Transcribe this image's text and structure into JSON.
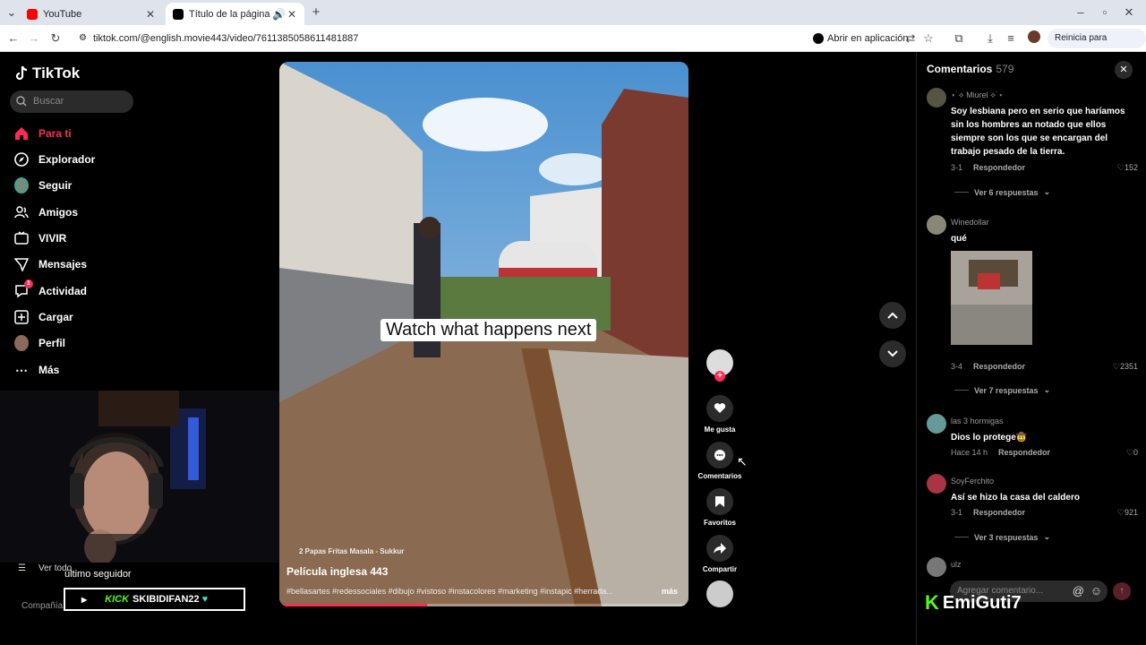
{
  "browser": {
    "tabs": [
      {
        "title": "YouTube",
        "favicon_color": "#ff0000"
      },
      {
        "title": "Título de la página de inicio",
        "favicon_color": "#000000"
      }
    ],
    "url": "tiktok.com/@english.movie443/video/7611385058611481887",
    "open_in_app": "Abrir en aplicación",
    "restart": "Reinicia para actualizar"
  },
  "sidebar": {
    "logo": "TikTok",
    "search_placeholder": "Buscar",
    "nav": [
      {
        "label": "Para ti",
        "icon": "home-icon"
      },
      {
        "label": "Explorador",
        "icon": "compass-icon"
      },
      {
        "label": "Seguir",
        "icon": "following-avatar-icon"
      },
      {
        "label": "Amigos",
        "icon": "friends-icon"
      },
      {
        "label": "VIVIR",
        "icon": "live-icon"
      },
      {
        "label": "Mensajes",
        "icon": "messages-icon"
      },
      {
        "label": "Actividad",
        "icon": "activity-icon",
        "badge": "1"
      },
      {
        "label": "Cargar",
        "icon": "upload-icon"
      },
      {
        "label": "Perfil",
        "icon": "profile-avatar-icon"
      },
      {
        "label": "Más",
        "icon": "more-icon"
      }
    ],
    "ver_todo": "Ver todo",
    "footer": "Compañía"
  },
  "stream_overlay": {
    "last_follower_label": "último seguidor",
    "kick_brand": "KICK",
    "follower_name": "SKIBIDIFAN22",
    "streamer_handle": "EmiGuti7"
  },
  "video": {
    "overlay_text": "Watch what happens next",
    "sound": "2 Papas Fritas Masala - Sukkur",
    "title": "Película inglesa 443",
    "hashtags": "#bellasartes #redessociales #dibujo #vistoso #instacolores #marketing #instapic #herrada...",
    "more": "más",
    "progress_percent": 36
  },
  "actions": {
    "like": "Me gusta",
    "comments": "Comentarios",
    "favorites": "Favoritos",
    "share": "Compartir"
  },
  "comments": {
    "header": "Comentarios",
    "count": "579",
    "items": [
      {
        "user": "⋆˙⟡ Miurel ⟡˙⋆",
        "text": "Soy lesbiana pero en serio que haríamos sin los hombres an notado que ellos siempre son los que se encargan del trabajo pesado de la tierra.",
        "date": "3-1",
        "reply": "Respondedor",
        "likes": "152",
        "replies": "Ver 6 respuestas"
      },
      {
        "user": "Winedollar",
        "text": "qué",
        "date": "3-4",
        "reply": "Respondedor",
        "likes": "2351",
        "replies": "Ver 7 respuestas"
      },
      {
        "user": "las 3 hormigas",
        "text": "Dios lo protege🤠",
        "date": "Hace 14 h",
        "reply": "Respondedor",
        "likes": "0"
      },
      {
        "user": "SoyFerchito",
        "text": "Así se hizo la casa del caldero",
        "date": "3-1",
        "reply": "Respondedor",
        "likes": "921",
        "replies": "Ver 3 respuestas"
      },
      {
        "user": "ulz"
      }
    ],
    "input_placeholder": "Agregar comentario..."
  }
}
